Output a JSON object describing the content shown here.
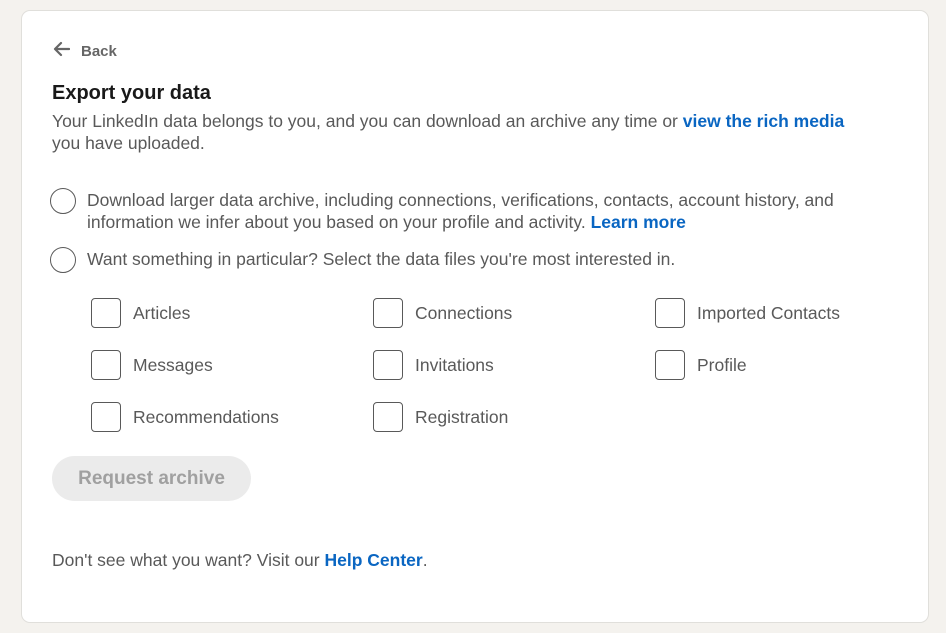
{
  "back": {
    "label": "Back",
    "icon": "arrow-left-icon"
  },
  "page": {
    "title": "Export your data",
    "description_prefix": "Your LinkedIn data belongs to you, and you can download an archive any time or ",
    "description_link": "view the rich media",
    "description_suffix": " you have uploaded."
  },
  "options": [
    {
      "label": "Download larger data archive, including connections, verifications, contacts, account history, and information we infer about you based on your profile and activity. ",
      "link": "Learn more",
      "selected": false
    },
    {
      "label": "Want something in particular? Select the data files you're most interested in.",
      "selected": false
    }
  ],
  "data_files": [
    {
      "label": "Articles",
      "checked": false
    },
    {
      "label": "Connections",
      "checked": false
    },
    {
      "label": "Imported Contacts",
      "checked": false
    },
    {
      "label": "Messages",
      "checked": false
    },
    {
      "label": "Invitations",
      "checked": false
    },
    {
      "label": "Profile",
      "checked": false
    },
    {
      "label": "Recommendations",
      "checked": false
    },
    {
      "label": "Registration",
      "checked": false
    }
  ],
  "request_button": {
    "label": "Request archive",
    "disabled": true
  },
  "footer": {
    "prefix": "Don't see what you want? Visit our ",
    "link": "Help Center",
    "suffix": "."
  },
  "colors": {
    "link": "#0a66c2",
    "background": "#f4f2ee",
    "button_disabled_bg": "#ebebeb"
  }
}
